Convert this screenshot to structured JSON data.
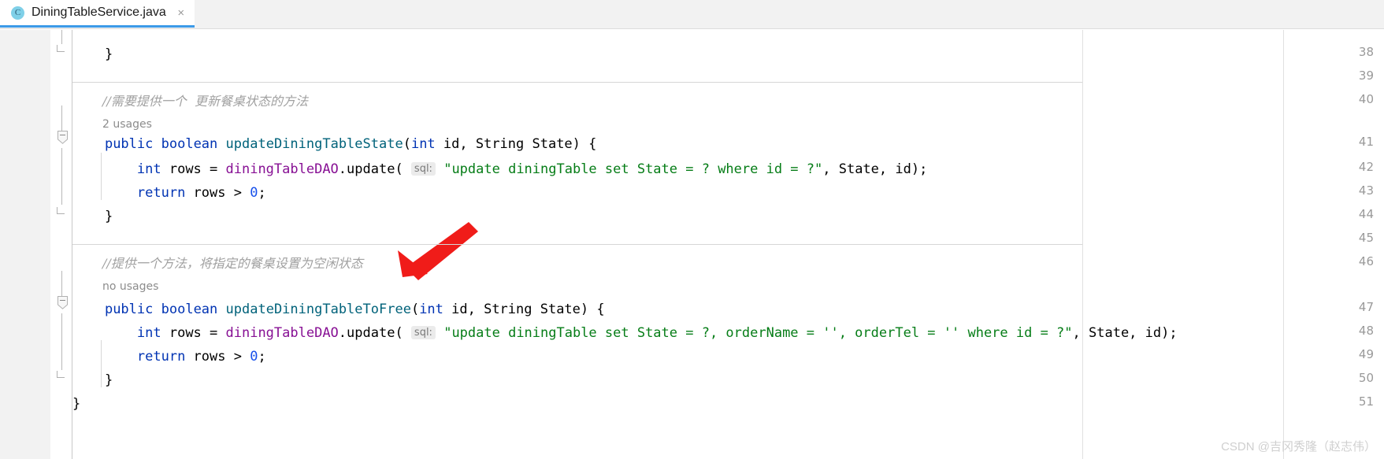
{
  "window": {
    "tab": {
      "icon": "java-class-icon",
      "title": "DiningTableService.java",
      "close": "×"
    }
  },
  "editor": {
    "line_numbers": [
      "38",
      "39",
      "40",
      "41",
      "42",
      "43",
      "44",
      "45",
      "46",
      "47",
      "48",
      "49",
      "50",
      "51"
    ],
    "lines": [
      {
        "number": "38",
        "segments": [
          {
            "t": "    }",
            "c": "pn"
          }
        ]
      },
      {
        "number": "39",
        "segments": [
          {
            "t": "",
            "c": "pn"
          }
        ]
      },
      {
        "number": "40",
        "comment": "//需要提供一个  更新餐桌状态的方法"
      },
      {
        "number": "41",
        "usages": "2 usages",
        "segments": [
          {
            "t": "    ",
            "c": "pn"
          },
          {
            "t": "public",
            "c": "kw"
          },
          {
            "t": " ",
            "c": "pn"
          },
          {
            "t": "boolean",
            "c": "kw"
          },
          {
            "t": " ",
            "c": "pn"
          },
          {
            "t": "updateDiningTableState",
            "c": "meth"
          },
          {
            "t": "(",
            "c": "pn"
          },
          {
            "t": "int",
            "c": "kw"
          },
          {
            "t": " id, String State) {",
            "c": "pn"
          }
        ]
      },
      {
        "number": "42",
        "segments": [
          {
            "t": "        ",
            "c": "pn"
          },
          {
            "t": "int",
            "c": "kw"
          },
          {
            "t": " rows = ",
            "c": "pn"
          },
          {
            "t": "diningTableDAO",
            "c": "fld"
          },
          {
            "t": ".update( ",
            "c": "pn"
          },
          {
            "t": "sql:",
            "c": "chip"
          },
          {
            "t": " ",
            "c": "pn"
          },
          {
            "t": "\"update diningTable set State = ? where id = ?\"",
            "c": "str"
          },
          {
            "t": ", State, id);",
            "c": "pn"
          }
        ]
      },
      {
        "number": "43",
        "segments": [
          {
            "t": "        ",
            "c": "pn"
          },
          {
            "t": "return",
            "c": "kw"
          },
          {
            "t": " rows > ",
            "c": "pn"
          },
          {
            "t": "0",
            "c": "num"
          },
          {
            "t": ";",
            "c": "pn"
          }
        ]
      },
      {
        "number": "44",
        "segments": [
          {
            "t": "    }",
            "c": "pn"
          }
        ]
      },
      {
        "number": "45",
        "segments": [
          {
            "t": "",
            "c": "pn"
          }
        ]
      },
      {
        "number": "46",
        "comment": "//提供一个方法，将指定的餐桌设置为空闲状态"
      },
      {
        "number": "47",
        "usages": "no usages",
        "segments": [
          {
            "t": "    ",
            "c": "pn"
          },
          {
            "t": "public",
            "c": "kw"
          },
          {
            "t": " ",
            "c": "pn"
          },
          {
            "t": "boolean",
            "c": "kw"
          },
          {
            "t": " ",
            "c": "pn"
          },
          {
            "t": "updateDiningTableToFree",
            "c": "meth"
          },
          {
            "t": "(",
            "c": "pn"
          },
          {
            "t": "int",
            "c": "kw"
          },
          {
            "t": " id, String State) {",
            "c": "pn"
          }
        ]
      },
      {
        "number": "48",
        "segments": [
          {
            "t": "        ",
            "c": "pn"
          },
          {
            "t": "int",
            "c": "kw"
          },
          {
            "t": " rows = ",
            "c": "pn"
          },
          {
            "t": "diningTableDAO",
            "c": "fld"
          },
          {
            "t": ".update( ",
            "c": "pn"
          },
          {
            "t": "sql:",
            "c": "chip"
          },
          {
            "t": " ",
            "c": "pn"
          },
          {
            "t": "\"update diningTable set State = ?, orderName = '', orderTel = '' where id = ?\"",
            "c": "str"
          },
          {
            "t": ", State, id);",
            "c": "pn"
          }
        ]
      },
      {
        "number": "49",
        "segments": [
          {
            "t": "        ",
            "c": "pn"
          },
          {
            "t": "return",
            "c": "kw"
          },
          {
            "t": " rows > ",
            "c": "pn"
          },
          {
            "t": "0",
            "c": "num"
          },
          {
            "t": ";",
            "c": "pn"
          }
        ]
      },
      {
        "number": "50",
        "segments": [
          {
            "t": "    }",
            "c": "pn"
          }
        ]
      },
      {
        "number": "51",
        "segments": [
          {
            "t": "}",
            "c": "pn"
          }
        ]
      }
    ]
  },
  "annotation": {
    "arrow_color": "#f01c19",
    "arrow_name": "red-pointer-arrow"
  },
  "watermark": {
    "text": "CSDN @吉冈秀隆（赵志伟）",
    "color": "#cfcfcf"
  }
}
